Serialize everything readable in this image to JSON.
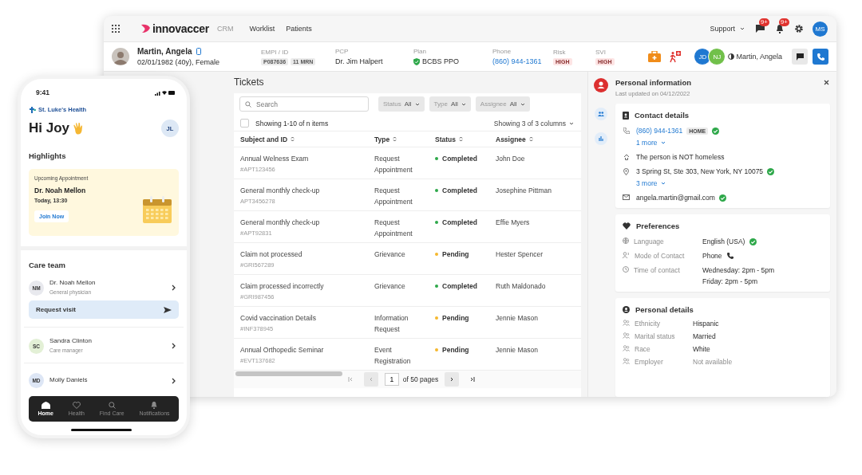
{
  "app": {
    "logo": "innovaccer",
    "product": "CRM",
    "nav": [
      {
        "label": "Worklist"
      },
      {
        "label": "Patients"
      }
    ],
    "support": "Support",
    "badges": [
      {
        "kind": "chat",
        "count": "9+"
      },
      {
        "kind": "bell",
        "count": "9+"
      }
    ],
    "user_initials": "MS"
  },
  "patient": {
    "name": "Martin, Angela",
    "dob": "02/01/1982 (40y), Female",
    "fields": [
      {
        "label": "EMPI / ID",
        "kind": "tags",
        "tags": [
          "P087636",
          "11 MRN"
        ]
      },
      {
        "label": "PCP",
        "kind": "text",
        "value": "Dr. Jim Halpert"
      },
      {
        "label": "Plan",
        "kind": "verified",
        "value": "BCBS PPO"
      },
      {
        "label": "Phone",
        "kind": "link",
        "value": "(860) 944-1361"
      },
      {
        "label": "Risk",
        "kind": "alert",
        "tags": [
          "HIGH"
        ]
      },
      {
        "label": "SVI",
        "kind": "alert",
        "tags": [
          "HIGH"
        ]
      }
    ],
    "care_team": [
      {
        "initials": "JD",
        "color": "#1f78d1"
      },
      {
        "initials": "NJ",
        "color": "#71c04a"
      }
    ],
    "contact_name": "Martin, Angela"
  },
  "tickets": {
    "title": "Tickets",
    "search_placeholder": "Search",
    "filters": [
      {
        "label": "Status",
        "value": "All"
      },
      {
        "label": "Type",
        "value": "All"
      },
      {
        "label": "Assignee",
        "value": "All"
      }
    ],
    "select_all": {
      "checked": false
    },
    "summary": "Showing 1-10 of n items",
    "columns_toggle": "Showing 3 of 3 columns",
    "columns": [
      "Subject and ID",
      "Type",
      "Status",
      "Assignee"
    ],
    "rows": [
      {
        "subject": "Annual Welness Exam",
        "id": "#APT123456",
        "type": [
          "Request",
          "Appointment"
        ],
        "status": "Completed",
        "color": "#2ea84a",
        "assignee": "John Doe"
      },
      {
        "subject": "General monthly check-up",
        "id": "APT3456278",
        "type": [
          "Request",
          "Appointment"
        ],
        "status": "Completed",
        "color": "#2ea84a",
        "assignee": "Josephine Pittman"
      },
      {
        "subject": "General monthly check-up",
        "id": "#APT92831",
        "type": [
          "Request",
          "Appointment"
        ],
        "status": "Completed",
        "color": "#2ea84a",
        "assignee": "Effie Myers"
      },
      {
        "subject": "Claim not processed",
        "id": "#GRI567289",
        "type": [
          "Grievance"
        ],
        "status": "Pending",
        "color": "#f5b82e",
        "assignee": "Hester Spencer"
      },
      {
        "subject": "Claim processed incorrectly",
        "id": "#GRI987456",
        "type": [
          "Grievance"
        ],
        "status": "Completed",
        "color": "#2ea84a",
        "assignee": "Ruth Maldonado"
      },
      {
        "subject": "Covid vaccination Details",
        "id": "#INF378945",
        "type": [
          "Information",
          "Request"
        ],
        "status": "Pending",
        "color": "#f5b82e",
        "assignee": "Jennie Mason"
      },
      {
        "subject": "Annual Orthopedic Seminar",
        "id": "#EVT137682",
        "type": [
          "Event",
          "Registration"
        ],
        "status": "Pending",
        "color": "#f5b82e",
        "assignee": "Jennie Mason"
      }
    ],
    "pagination": {
      "page": "1",
      "of": "of 50 pages"
    }
  },
  "info": {
    "title": "Personal information",
    "subtitle": "Last updated on 04/12/2022",
    "contact": {
      "title": "Contact details",
      "items": [
        {
          "kind": "phone",
          "value": "(860) 944-1361",
          "tag": "HOME",
          "verified": true,
          "more": "1 more"
        },
        {
          "kind": "housing",
          "value": "The person is NOT homeless",
          "verified": false
        },
        {
          "kind": "address",
          "value": "3 Spring St, Ste 303, New York, NY 10075",
          "verified": true,
          "more": "3 more"
        },
        {
          "kind": "email",
          "value": "angela.martin@gmail.com",
          "verified": true
        }
      ]
    },
    "preferences": {
      "title": "Preferences",
      "rows": [
        {
          "kind": "language",
          "label": "Language",
          "values": [
            "English (USA)"
          ],
          "verified": true
        },
        {
          "kind": "mode",
          "label": "Mode of Contact",
          "values": [
            "Phone"
          ],
          "verified": false
        },
        {
          "kind": "time",
          "label": "Time of contact",
          "values": [
            "Wednesday: 2pm - 5pm",
            "Friday: 2pm - 5pm"
          ],
          "verified": false
        }
      ]
    },
    "personal": {
      "title": "Personal details",
      "rows": [
        {
          "label": "Ethnicity",
          "value": "Hispanic",
          "muted": false
        },
        {
          "label": "Marital status",
          "value": "Married",
          "muted": false
        },
        {
          "label": "Race",
          "value": "White",
          "muted": false
        },
        {
          "label": "Employer",
          "value": "Not available",
          "muted": true
        }
      ]
    }
  },
  "phone": {
    "time": "9:41",
    "brand": "St. Luke's Health",
    "greeting": "Hi Joy",
    "avatar": "JL",
    "highlights": "Highlights",
    "appointment": {
      "label": "Upcoming Appointment",
      "doctor": "Dr. Noah Mellon",
      "when": "Today, 13:30",
      "action": "Join Now"
    },
    "care_title": "Care team",
    "care_team": [
      {
        "initials": "NM",
        "name": "Dr. Noah Mellon",
        "role": "General physician",
        "color": "#e8e9ee",
        "action": "Request visit"
      },
      {
        "initials": "SC",
        "name": "Sandra Clinton",
        "role": "Care manager",
        "color": "#e3f0d6"
      },
      {
        "initials": "MD",
        "name": "Molly Daniels",
        "color": "#dde6f5"
      }
    ],
    "nav": [
      {
        "kind": "home",
        "label": "Home",
        "selected": true
      },
      {
        "kind": "health",
        "label": "Health",
        "selected": false
      },
      {
        "kind": "find",
        "label": "Find Care",
        "selected": false
      },
      {
        "kind": "bell",
        "label": "Notifications",
        "selected": false
      }
    ]
  }
}
